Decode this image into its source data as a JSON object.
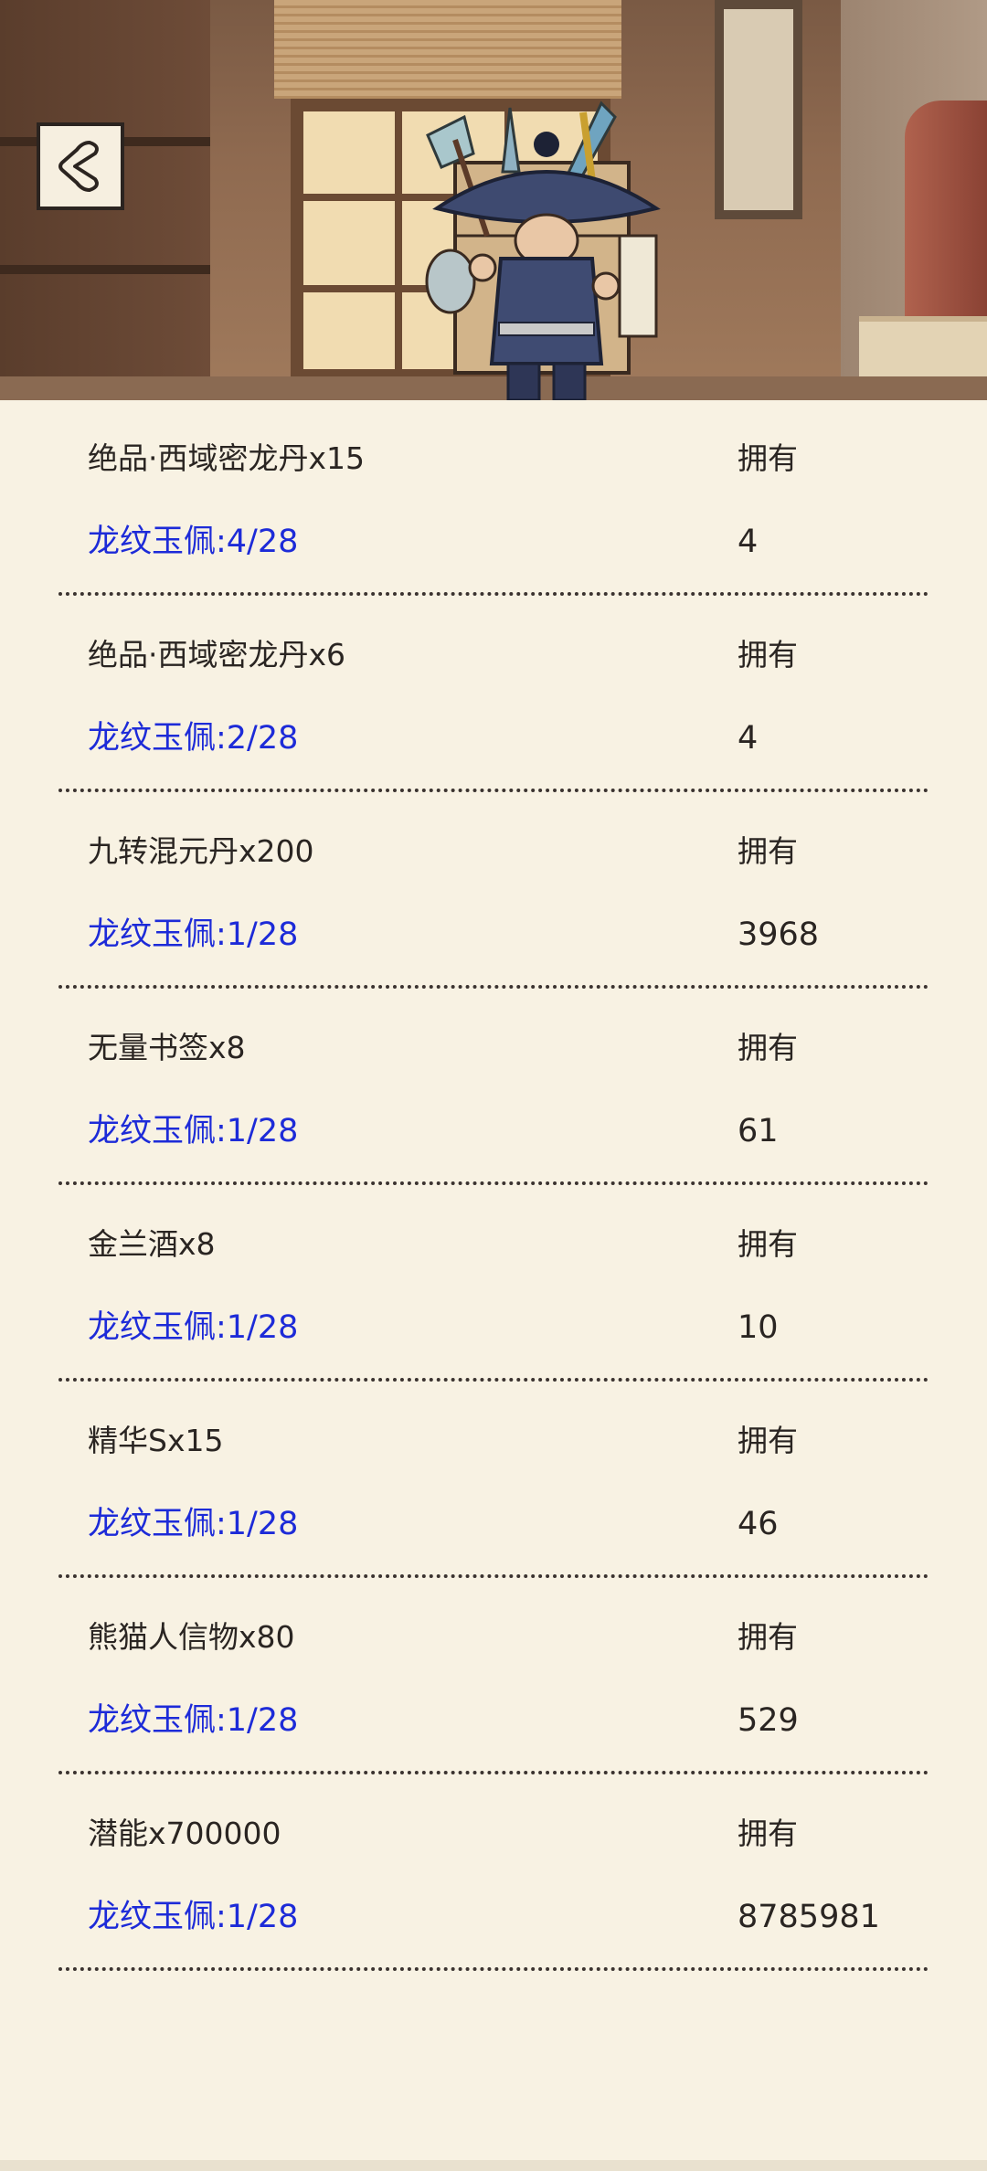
{
  "header": {
    "back_icon": "chevron-left-icon",
    "scene": "merchant-character-illustration"
  },
  "items": [
    {
      "name": "绝品·西域密龙丹x15",
      "progress": "龙纹玉佩:4/28",
      "own_label": "拥有",
      "own_count": "4"
    },
    {
      "name": "绝品·西域密龙丹x6",
      "progress": "龙纹玉佩:2/28",
      "own_label": "拥有",
      "own_count": "4"
    },
    {
      "name": "九转混元丹x200",
      "progress": "龙纹玉佩:1/28",
      "own_label": "拥有",
      "own_count": "3968"
    },
    {
      "name": "无量书签x8",
      "progress": "龙纹玉佩:1/28",
      "own_label": "拥有",
      "own_count": "61"
    },
    {
      "name": "金兰酒x8",
      "progress": "龙纹玉佩:1/28",
      "own_label": "拥有",
      "own_count": "10"
    },
    {
      "name": "精华Sx15",
      "progress": "龙纹玉佩:1/28",
      "own_label": "拥有",
      "own_count": "46"
    },
    {
      "name": "熊猫人信物x80",
      "progress": "龙纹玉佩:1/28",
      "own_label": "拥有",
      "own_count": "529"
    },
    {
      "name": "潜能x700000",
      "progress": "龙纹玉佩:1/28",
      "own_label": "拥有",
      "own_count": "8785981"
    }
  ],
  "colors": {
    "background": "#f8f2e3",
    "progress_text": "#1d2bd8",
    "primary_text": "#2a2522"
  }
}
